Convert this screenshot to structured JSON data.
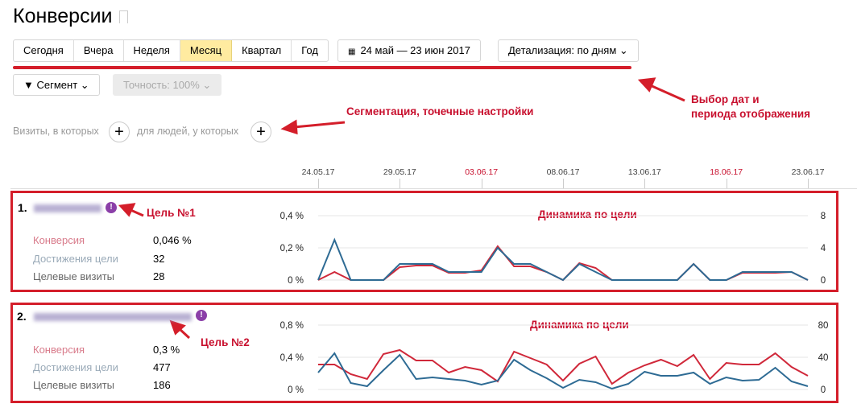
{
  "header": {
    "title": "Конверсии"
  },
  "periods": [
    {
      "label": "Сегодня",
      "active": false
    },
    {
      "label": "Вчера",
      "active": false
    },
    {
      "label": "Неделя",
      "active": false
    },
    {
      "label": "Месяц",
      "active": true
    },
    {
      "label": "Квартал",
      "active": false
    },
    {
      "label": "Год",
      "active": false
    }
  ],
  "date_range": "24 май — 23 июн 2017",
  "detail": "Детализация: по дням",
  "segment": "Сегмент",
  "accuracy": "Точность: 100%",
  "filters": {
    "visits": "Визиты, в которых",
    "people": "для людей, у которых"
  },
  "annotations": {
    "dates": "Выбор дат и\nпериода отображения",
    "dates_l1": "Выбор дат и",
    "dates_l2": "периода отображения",
    "segment": "Сегментация, точечные настройки",
    "goal1": "Цель №1",
    "goal2": "Цель №2",
    "dyn": "Динамика по цели"
  },
  "ticks": [
    {
      "label": "24.05.17",
      "day": 0,
      "holiday": false
    },
    {
      "label": "29.05.17",
      "day": 5,
      "holiday": false
    },
    {
      "label": "03.06.17",
      "day": 10,
      "holiday": true
    },
    {
      "label": "08.06.17",
      "day": 15,
      "holiday": false
    },
    {
      "label": "13.06.17",
      "day": 20,
      "holiday": false
    },
    {
      "label": "18.06.17",
      "day": 25,
      "holiday": true
    },
    {
      "label": "23.06.17",
      "day": 30,
      "holiday": false
    }
  ],
  "goals": [
    {
      "num": "1.",
      "metrics": [
        {
          "label": "Конверсия",
          "value": "0,046 %"
        },
        {
          "label": "Достижения цели",
          "value": "32"
        },
        {
          "label": "Целевые визиты",
          "value": "28"
        }
      ]
    },
    {
      "num": "2.",
      "metrics": [
        {
          "label": "Конверсия",
          "value": "0,3 %"
        },
        {
          "label": "Достижения цели",
          "value": "477"
        },
        {
          "label": "Целевые визиты",
          "value": "186"
        }
      ]
    }
  ],
  "colors": {
    "conversion": "#d0283a",
    "visits": "#2e6b94",
    "annotation": "#c8102e"
  },
  "chart_data": [
    {
      "type": "line",
      "x_ticks": [
        "24.05.17",
        "29.05.17",
        "03.06.17",
        "08.06.17",
        "13.06.17",
        "18.06.17",
        "23.06.17"
      ],
      "left_axis": {
        "ticks": [
          "0 %",
          "0,2 %",
          "0,4 %"
        ],
        "range": [
          0,
          0.4
        ]
      },
      "right_axis": {
        "ticks": [
          "0",
          "4",
          "8"
        ],
        "range": [
          0,
          8
        ]
      },
      "series": [
        {
          "axis": "left",
          "color": "#d0283a",
          "values": [
            0,
            0.05,
            0,
            0,
            0,
            0.08,
            0.09,
            0.09,
            0.045,
            0.045,
            0.06,
            0.21,
            0.085,
            0.085,
            0.05,
            0,
            0.105,
            0.075,
            0,
            0,
            0,
            0,
            0,
            0.1,
            0,
            0,
            0.045,
            0.045,
            0.045,
            0.05,
            0
          ]
        },
        {
          "axis": "right",
          "color": "#2e6b94",
          "values": [
            0,
            5,
            0,
            0,
            0,
            2,
            2,
            2,
            1,
            1,
            1,
            4,
            2,
            2,
            1,
            0,
            2,
            1,
            0,
            0,
            0,
            0,
            0,
            2,
            0,
            0,
            1,
            1,
            1,
            1,
            0
          ]
        }
      ]
    },
    {
      "type": "line",
      "x_ticks": [
        "24.05.17",
        "29.05.17",
        "03.06.17",
        "08.06.17",
        "13.06.17",
        "18.06.17",
        "23.06.17"
      ],
      "left_axis": {
        "ticks": [
          "0 %",
          "0,4 %",
          "0,8 %"
        ],
        "range": [
          0,
          0.8
        ]
      },
      "right_axis": {
        "ticks": [
          "0",
          "40",
          "80"
        ],
        "range": [
          0,
          80
        ]
      },
      "series": [
        {
          "axis": "left",
          "color": "#d0283a",
          "values": [
            0.31,
            0.31,
            0.19,
            0.13,
            0.44,
            0.49,
            0.36,
            0.36,
            0.21,
            0.28,
            0.24,
            0.1,
            0.47,
            0.39,
            0.31,
            0.11,
            0.32,
            0.41,
            0.07,
            0.21,
            0.3,
            0.37,
            0.29,
            0.43,
            0.13,
            0.33,
            0.31,
            0.31,
            0.45,
            0.28,
            0.17
          ]
        },
        {
          "axis": "right",
          "color": "#2e6b94",
          "values": [
            21,
            45,
            8,
            4,
            24,
            43,
            13,
            15,
            13,
            11,
            6,
            11,
            37,
            24,
            14,
            2,
            12,
            9,
            1,
            7,
            22,
            17,
            17,
            21,
            7,
            15,
            11,
            12,
            27,
            10,
            4
          ]
        }
      ]
    }
  ]
}
